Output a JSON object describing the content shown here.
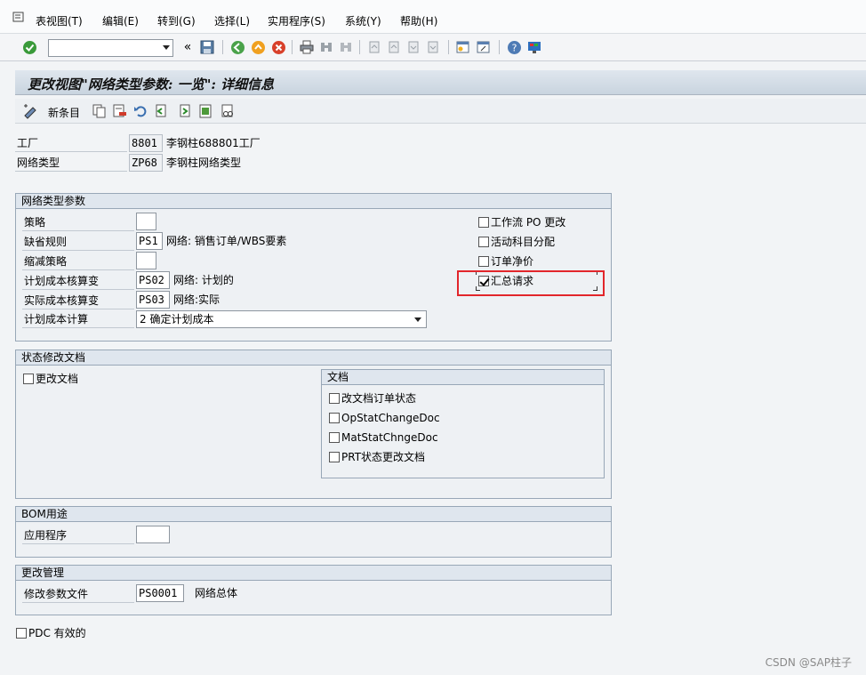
{
  "menubar": {
    "items": [
      "表视图(T)",
      "编辑(E)",
      "转到(G)",
      "选择(L)",
      "实用程序(S)",
      "系统(Y)",
      "帮助(H)"
    ]
  },
  "toolbar": {
    "command_value": "",
    "nav_symbol": "«"
  },
  "title": "更改视图\"网络类型参数: 一览\": 详细信息",
  "app_toolbar": {
    "new_entries_label": "新条目"
  },
  "header": {
    "plant_label": "工厂",
    "plant_value": "8801",
    "plant_desc": "李钢柱688801工厂",
    "network_type_label": "网络类型",
    "network_type_value": "ZP68",
    "network_type_desc": "李钢柱网络类型"
  },
  "params_group": {
    "title": "网络类型参数",
    "strategy_label": "策略",
    "strategy_value": "",
    "default_rule_label": "缺省规则",
    "default_rule_value": "PS1",
    "default_rule_desc": "网络: 销售订单/WBS要素",
    "reduction_label": "缩减策略",
    "reduction_value": "",
    "plan_cost_variant_label": "计划成本核算变",
    "plan_cost_variant_value": "PS02",
    "plan_cost_variant_desc": "网络: 计划的",
    "actual_cost_variant_label": "实际成本核算变",
    "actual_cost_variant_value": "PS03",
    "actual_cost_variant_desc": "网络:实际",
    "plan_cost_calc_label": "计划成本计算",
    "plan_cost_calc_value": "2 确定计划成本",
    "checkboxes": [
      {
        "label": "工作流 PO 更改",
        "checked": false
      },
      {
        "label": "活动科目分配",
        "checked": false
      },
      {
        "label": "订单净价",
        "checked": false
      },
      {
        "label": "汇总请求",
        "checked": true
      }
    ]
  },
  "status_group": {
    "title": "状态修改文档",
    "change_docs_label": "更改文档",
    "docs_subgroup": {
      "title": "文档",
      "checkboxes": [
        {
          "label": "改文档订单状态",
          "checked": false
        },
        {
          "label": "OpStatChangeDoc",
          "checked": false
        },
        {
          "label": "MatStatChngeDoc",
          "checked": false
        },
        {
          "label": "PRT状态更改文档",
          "checked": false
        }
      ]
    }
  },
  "bom_group": {
    "title": "BOM用途",
    "app_label": "应用程序",
    "app_value": ""
  },
  "change_mgmt_group": {
    "title": "更改管理",
    "profile_label": "修改参数文件",
    "profile_value": "PS0001",
    "profile_desc": "网络总体"
  },
  "pdc": {
    "label": "PDC 有效的",
    "checked": false
  },
  "watermark": "CSDN @SAP柱子",
  "colors": {
    "highlight": "#e2262b",
    "group_border": "#98a7b7",
    "title_bg": "#c9d4df"
  }
}
